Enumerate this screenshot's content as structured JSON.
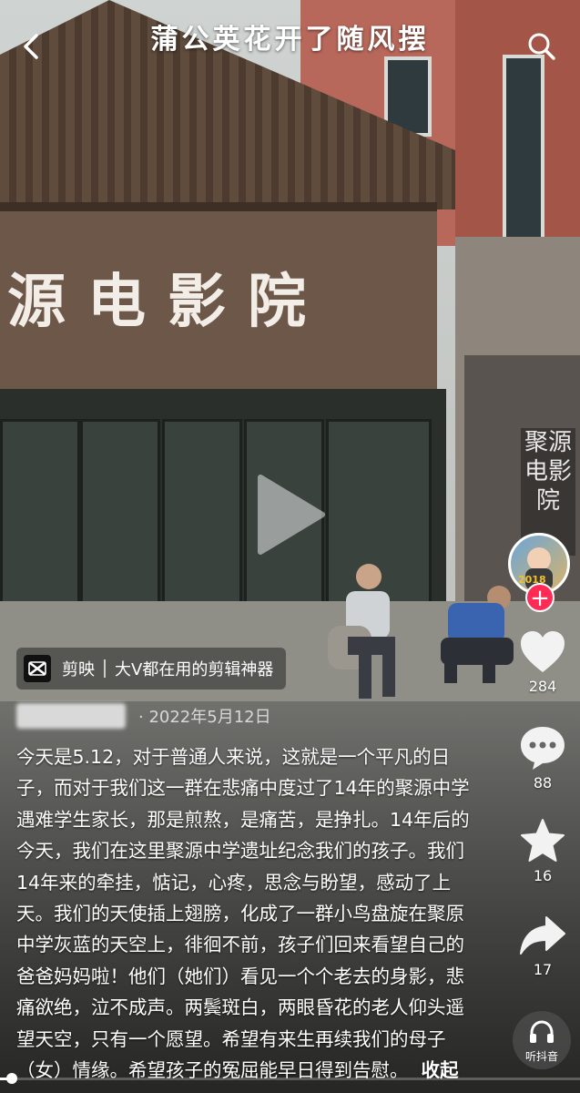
{
  "header": {
    "title": "蒲公英花开了随风摆",
    "back_icon": "chevron-left-icon",
    "search_icon": "search-icon"
  },
  "scene": {
    "cinema_sign": "源电影院",
    "mural_text": "聚源电影院"
  },
  "right_rail": {
    "avatar_badge": "2018",
    "follow_symbol": "+",
    "like_count": "284",
    "comment_count": "88",
    "favorite_count": "16",
    "share_count": "17",
    "listen_label": "听抖音"
  },
  "promo": {
    "brand": "剪映",
    "slogan": "大V都在用的剪辑神器"
  },
  "post": {
    "date": "· 2022年5月12日",
    "caption": "今天是5.12，对于普通人来说，这就是一个平凡的日子，而对于我们这一群在悲痛中度过了14年的聚源中学遇难学生家长，那是煎熬，是痛苦，是挣扎。14年后的今天，我们在这里聚源中学遗址纪念我们的孩子。我们14年来的牵挂，惦记，心疼，思念与盼望，感动了上天。我们的天使插上翅膀，化成了一群小鸟盘旋在聚原中学灰蓝的天空上，徘徊不前，孩子们回来看望自己的爸爸妈妈啦！他们（她们）看见一个个老去的身影，悲痛欲绝，泣不成声。两鬓斑白，两眼昏花的老人仰头遥望天空，只有一个愿望。希望有来生再续我们的母子（女）情缘。希望孩子的冤屈能早日得到告慰。",
    "collapse_label": "收起"
  },
  "playback": {
    "progress": 0.02
  },
  "colors": {
    "accent": "#fe2c55",
    "text": "#ffffff"
  }
}
